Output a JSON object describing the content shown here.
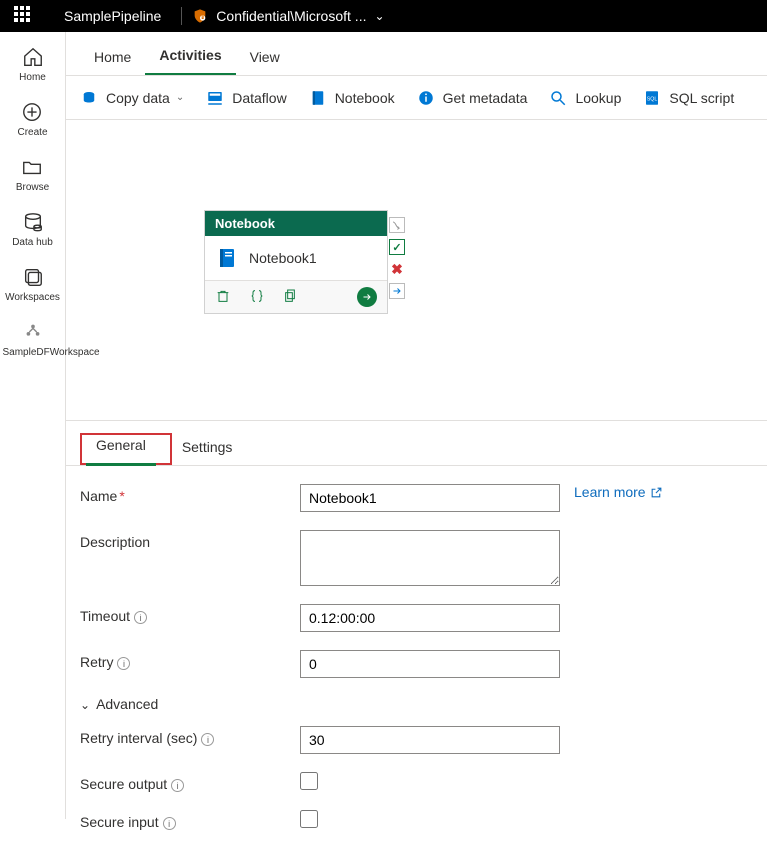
{
  "header": {
    "pipeline_name": "SamplePipeline",
    "sensitivity": "Confidential\\Microsoft ..."
  },
  "leftnav": {
    "home": "Home",
    "create": "Create",
    "browse": "Browse",
    "datahub": "Data hub",
    "workspaces": "Workspaces",
    "workspace_name": "SampleDFWorkspace"
  },
  "tabs": {
    "home": "Home",
    "activities": "Activities",
    "view": "View"
  },
  "toolbar": {
    "copy_data": "Copy data",
    "dataflow": "Dataflow",
    "notebook": "Notebook",
    "get_metadata": "Get metadata",
    "lookup": "Lookup",
    "sql_script": "SQL script"
  },
  "node": {
    "type_label": "Notebook",
    "activity_name": "Notebook1"
  },
  "properties": {
    "tabs": {
      "general": "General",
      "settings": "Settings"
    },
    "labels": {
      "name": "Name",
      "description": "Description",
      "timeout": "Timeout",
      "retry": "Retry",
      "advanced": "Advanced",
      "retry_interval": "Retry interval (sec)",
      "secure_output": "Secure output",
      "secure_input": "Secure input",
      "learn_more": "Learn more"
    },
    "values": {
      "name": "Notebook1",
      "description": "",
      "timeout": "0.12:00:00",
      "retry": "0",
      "retry_interval": "30",
      "secure_output": false,
      "secure_input": false
    }
  }
}
